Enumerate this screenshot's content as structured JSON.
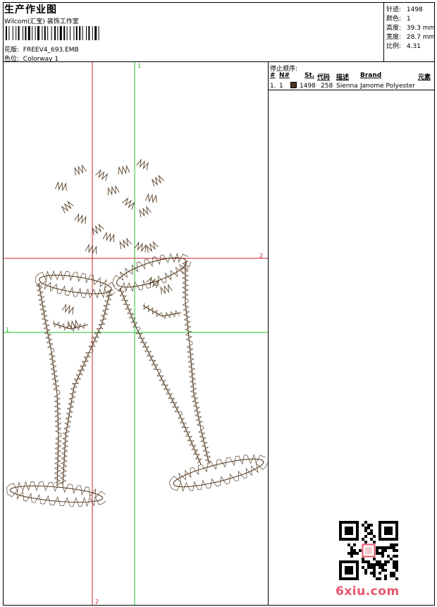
{
  "header": {
    "title": "生产作业图",
    "maker": "Wilcom(汇宝) 装饰工作室",
    "design_label": "花版:",
    "design_value": "FREEV4_693.EMB",
    "colorway_label": "色位:",
    "colorway_value": "Colorway 1"
  },
  "stats": [
    {
      "label": "针迹:",
      "value": "1498"
    },
    {
      "label": "颜色:",
      "value": "1"
    },
    {
      "label": "高度:",
      "value": "39.3 mm"
    },
    {
      "label": "宽度:",
      "value": "28.7 mm"
    },
    {
      "label": "比例:",
      "value": "4.31"
    }
  ],
  "stop_sequence": {
    "title": "停止顺序:",
    "columns": [
      "#",
      "N#",
      "St.",
      "代码",
      "描述",
      "Brand",
      "元素"
    ],
    "rows": [
      {
        "index": "1.",
        "needle": "1",
        "stitches": "1498",
        "code": "258",
        "description": "Sienna",
        "brand": "Janome Polyester",
        "color": "#4a3520"
      }
    ]
  },
  "guides": {
    "label_1": "1",
    "label_2": "2"
  },
  "thread_color": "#5a4028",
  "watermark": {
    "text": "6xiu.com",
    "color": "#e8566a"
  }
}
